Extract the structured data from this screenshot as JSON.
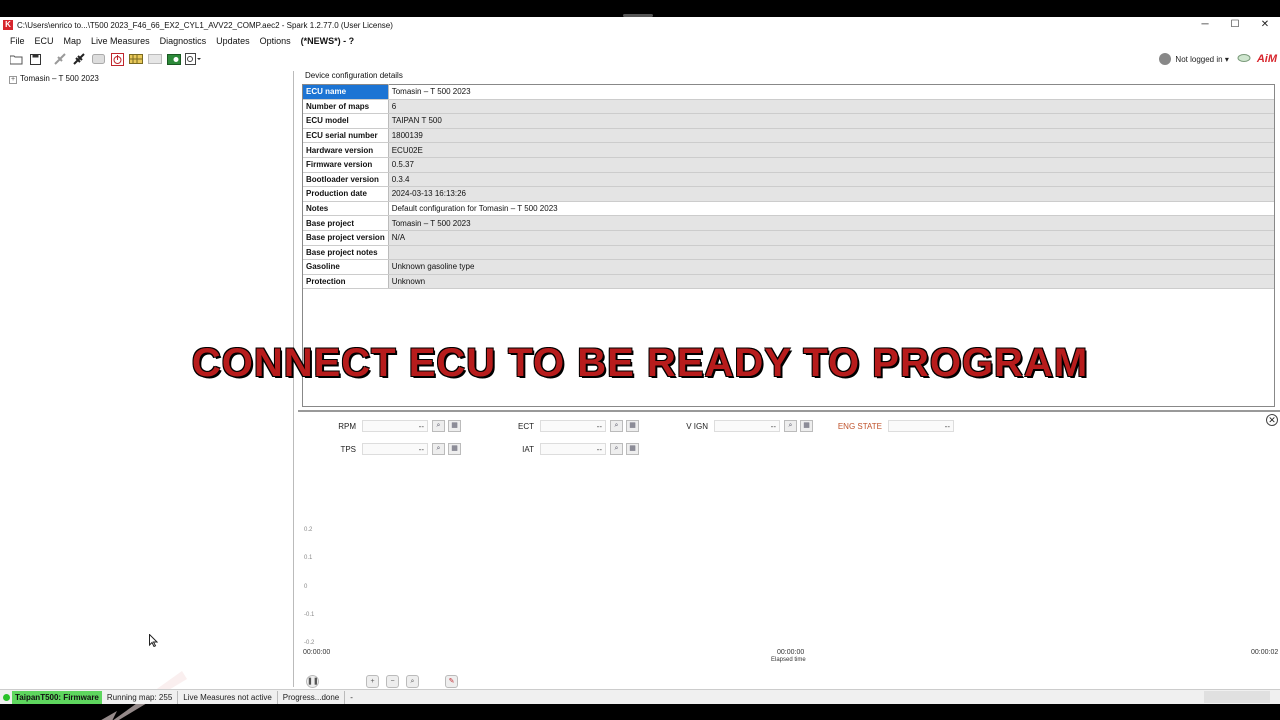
{
  "window": {
    "title": "C:\\Users\\enrico to...\\T500 2023_F46_66_EX2_CYL1_AVV22_COMP.aec2 - Spark 1.2.77.0 (User License)",
    "logo_letter": "K",
    "controls": {
      "minimize": "─",
      "maximize": "☐",
      "close": "✕"
    }
  },
  "menu": {
    "items": [
      "File",
      "ECU",
      "Map",
      "Live Measures",
      "Diagnostics",
      "Updates",
      "Options"
    ],
    "news": "(*NEWS*) - ?"
  },
  "toolbar": {
    "user": "Not logged in",
    "user_caret": "▾",
    "brand": "AiM"
  },
  "tree": {
    "expander": "+",
    "root_label": "Tomasin – T 500 2023"
  },
  "config": {
    "caption": "Device configuration details",
    "rows": [
      {
        "key": "ECU name",
        "value": "Tomasin – T 500 2023"
      },
      {
        "key": "Number of maps",
        "value": "6"
      },
      {
        "key": "ECU model",
        "value": "TAIPAN T 500"
      },
      {
        "key": "ECU serial number",
        "value": "1800139"
      },
      {
        "key": "Hardware version",
        "value": "ECU02E"
      },
      {
        "key": "Firmware version",
        "value": "0.5.37"
      },
      {
        "key": "Bootloader version",
        "value": "0.3.4"
      },
      {
        "key": "Production date",
        "value": "2024-03-13 16:13:26"
      },
      {
        "key": "Notes",
        "value": "Default configuration for Tomasin – T 500 2023"
      },
      {
        "key": "Base project",
        "value": "Tomasin – T 500 2023"
      },
      {
        "key": "Base project version",
        "value": "N/A"
      },
      {
        "key": "Base project notes",
        "value": ""
      },
      {
        "key": "Gasoline",
        "value": "Unknown gasoline type"
      },
      {
        "key": "Protection",
        "value": "Unknown"
      }
    ]
  },
  "banner": "CONNECT ECU TO BE READY TO PROGRAM",
  "live": {
    "measures": [
      {
        "label": "RPM",
        "value": "--"
      },
      {
        "label": "ECT",
        "value": "--"
      },
      {
        "label": "V IGN",
        "value": "--"
      },
      {
        "label": "ENG STATE",
        "value": "--"
      },
      {
        "label": "TPS",
        "value": "--"
      },
      {
        "label": "IAT",
        "value": "--"
      }
    ],
    "y_ticks": [
      "0.2",
      "0.1",
      "0",
      "-0.1",
      "-0.2"
    ],
    "time_start": "00:00:00",
    "time_mid": "00:00:00",
    "time_end": "00:00:02",
    "elapsed_label": "Elapsed time",
    "close_symbol": "✕"
  },
  "status": {
    "ecu": "TaipanT500: Firmware",
    "running_map": "Running map: 255",
    "live_state": "Live Measures not active",
    "progress": "Progress...done",
    "extra": "-"
  }
}
